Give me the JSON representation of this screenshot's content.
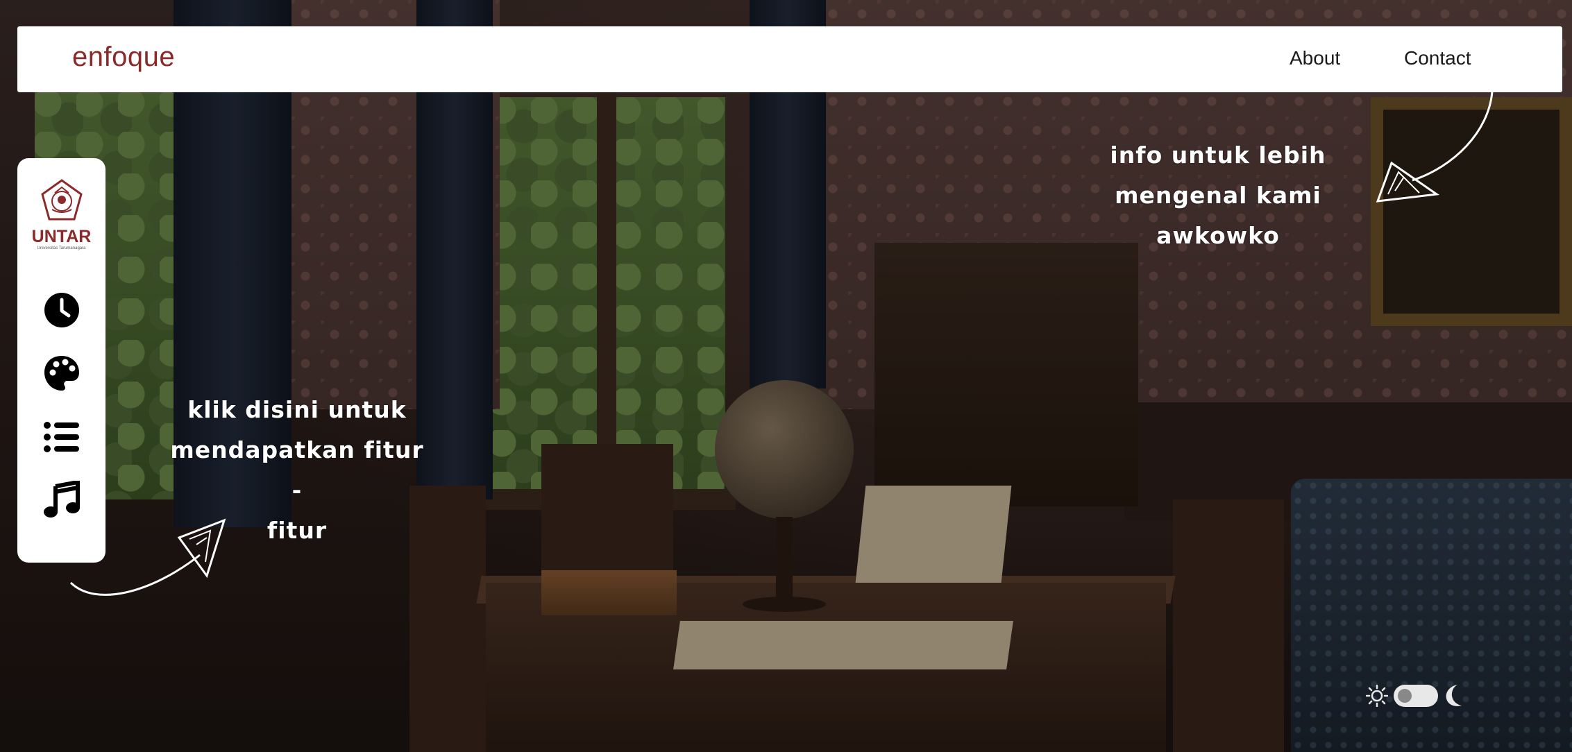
{
  "navbar": {
    "brand": "enfoque",
    "links": [
      {
        "label": "About"
      },
      {
        "label": "Contact"
      }
    ]
  },
  "sidebar": {
    "logo": {
      "text": "UNTAR",
      "subtext": "Universitas Tarumanagara"
    },
    "items": [
      {
        "icon": "clock-icon"
      },
      {
        "icon": "palette-icon"
      },
      {
        "icon": "list-icon"
      },
      {
        "icon": "music-note-icon"
      }
    ]
  },
  "notes": {
    "info": [
      "info untuk lebih",
      "mengenal kami",
      "awkowko"
    ],
    "klik": [
      "klik disini untuk",
      "mendapatkan fitur -",
      "fitur"
    ]
  },
  "theme": {
    "light_icon": "sun-icon",
    "dark_icon": "moon-icon",
    "mode": "light"
  },
  "colors": {
    "brand": "#8b2a2a",
    "panel": "#ffffff",
    "note_text": "#ffffff"
  }
}
